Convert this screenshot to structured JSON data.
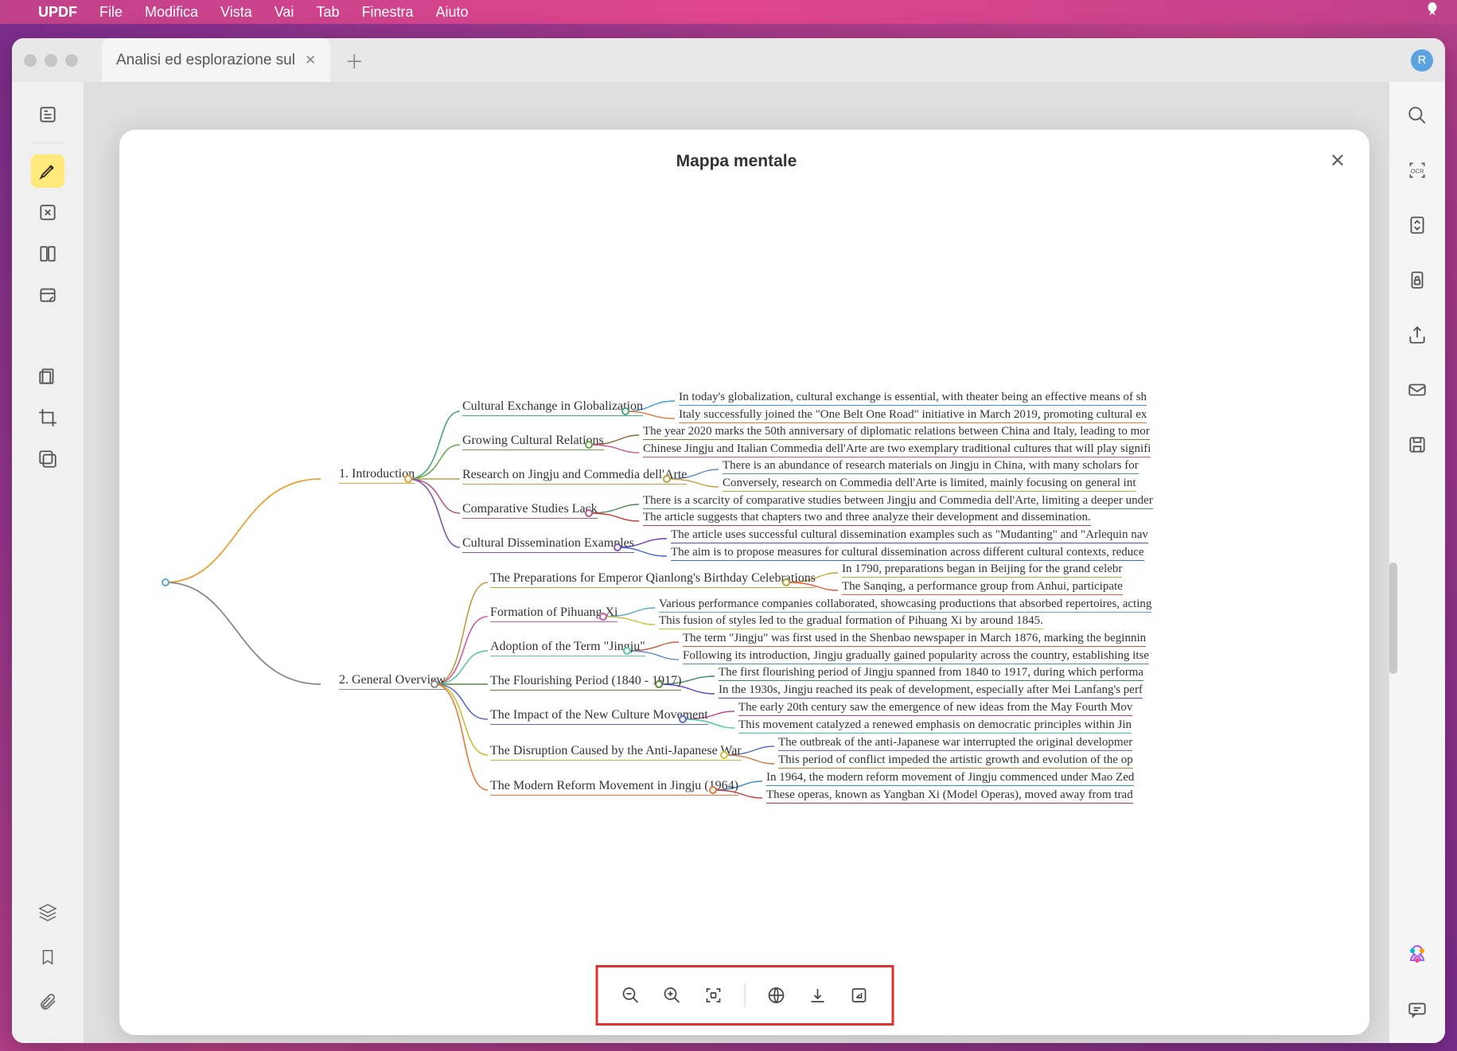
{
  "menubar": {
    "app": "UPDF",
    "items": [
      "File",
      "Modifica",
      "Vista",
      "Vai",
      "Tab",
      "Finestra",
      "Aiuto"
    ]
  },
  "tab": {
    "title": "Analisi ed esplorazione sul"
  },
  "user_initial": "R",
  "modal": {
    "title": "Mappa mentale"
  },
  "mindmap": {
    "branch1": {
      "title": "1. Introduction"
    },
    "branch2": {
      "title": "2. General Overview"
    },
    "b1": {
      "s1": {
        "title": "Cultural Exchange in Globalization",
        "l1": "In today's globalization, cultural exchange is essential, with theater being an effective means of sh",
        "l2": "Italy successfully joined the \"One Belt One Road\" initiative in March 2019, promoting cultural ex"
      },
      "s2": {
        "title": "Growing Cultural Relations",
        "l1": "The year 2020 marks the 50th anniversary of diplomatic relations between China and Italy, leading to mor",
        "l2": "Chinese Jingju and Italian Commedia dell'Arte are two exemplary traditional cultures that will play signifi"
      },
      "s3": {
        "title": "Research on Jingju and Commedia dell'Arte",
        "l1": "There is an abundance of research materials on Jingju in China, with many scholars for",
        "l2": "Conversely, research on Commedia dell'Arte is limited, mainly focusing on general int"
      },
      "s4": {
        "title": "Comparative Studies Lack",
        "l1": "There is a scarcity of comparative studies between Jingju and Commedia dell'Arte, limiting a deeper under",
        "l2": "The article suggests that chapters two and three analyze their development and dissemination."
      },
      "s5": {
        "title": "Cultural Dissemination Examples",
        "l1": "The article uses successful cultural dissemination examples such as \"Mudanting\" and \"Arlequin nav",
        "l2": "The aim is to propose measures for cultural dissemination across different cultural contexts, reduce"
      }
    },
    "b2": {
      "s1": {
        "title": "The Preparations for Emperor Qianlong's Birthday Celebrations",
        "l1": "In 1790, preparations began in Beijing for the grand celebr",
        "l2": "The Sanqing, a performance group from Anhui, participate"
      },
      "s2": {
        "title": "Formation of Pihuang Xi",
        "l1": "Various performance companies collaborated, showcasing productions that absorbed repertoires, acting",
        "l2": "This fusion of styles led to the gradual formation of Pihuang Xi by around 1845."
      },
      "s3": {
        "title": "Adoption of the Term \"Jingju\"",
        "l1": "The term \"Jingju\" was first used in the Shenbao newspaper in March 1876, marking the beginnin",
        "l2": "Following its introduction, Jingju gradually gained popularity across the country, establishing itse"
      },
      "s4": {
        "title": "The Flourishing Period (1840 - 1917)",
        "l1": "The first flourishing period of Jingju spanned from 1840 to 1917, during which performa",
        "l2": "In the 1930s, Jingju reached its peak of development, especially after Mei Lanfang's perf"
      },
      "s5": {
        "title": "The Impact of the New Culture Movement",
        "l1": "The early 20th century saw the emergence of new ideas from the May Fourth Mov",
        "l2": "This movement catalyzed a renewed emphasis on democratic principles within Jin"
      },
      "s6": {
        "title": "The Disruption Caused by the Anti-Japanese War",
        "l1": "The outbreak of the anti-Japanese war interrupted the original developmer",
        "l2": "This period of conflict impeded the artistic growth and evolution of the op"
      },
      "s7": {
        "title": "The Modern Reform Movement in Jingju (1964)",
        "l1": "In 1964, the modern reform movement of Jingju commenced under Mao Zed",
        "l2": "These operas, known as Yangban Xi (Model Operas), moved away from trad"
      }
    }
  }
}
